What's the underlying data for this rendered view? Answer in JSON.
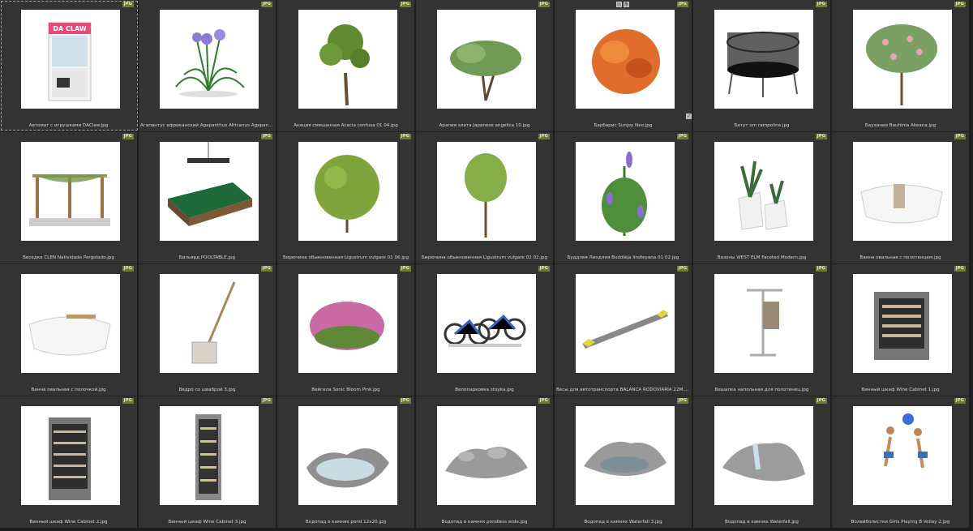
{
  "colors": {
    "background": "#1f1f1f",
    "cell": "#333333",
    "badge": "#6f7a33",
    "caption": "#d8d8d8"
  },
  "items": [
    {
      "name": "Автомат с игрушками DAClaw.jpg",
      "badge": "JPG",
      "kind": "claw",
      "title": "DA CLAW",
      "selected": true
    },
    {
      "name": "Агапантус африканский Agapanthus Africanus Agapanto ...",
      "badge": "JPG",
      "kind": "flower-blue"
    },
    {
      "name": "Акация смешанная Acacia confusa 01 04.jpg",
      "badge": "JPG",
      "kind": "tree"
    },
    {
      "name": "Аралия элата Japanese angelica 10.jpg",
      "badge": "JPG",
      "kind": "bush-wide"
    },
    {
      "name": "Барбарис Sunjoy Neo.jpg",
      "badge": "JPG",
      "kind": "orange-bush",
      "tools": [
        "square-icon",
        "pencil-icon"
      ],
      "checked": true
    },
    {
      "name": "Батут om rampoline.jpg",
      "badge": "JPG",
      "kind": "trampoline"
    },
    {
      "name": "Баухиния Bauhinia Akeana.jpg",
      "badge": "JPG",
      "kind": "blossom-tree"
    },
    {
      "name": "Беседка CLEN Natividade Pergolado.jpg",
      "badge": "JPG",
      "kind": "pergola"
    },
    {
      "name": "Бильярд POOLTABLE.jpg",
      "badge": "JPG",
      "kind": "pooltable"
    },
    {
      "name": "Бирючина обыкновенная Ligustrum vulgare 01 06.jpg",
      "badge": "JPG",
      "kind": "round-bush"
    },
    {
      "name": "Бирючина обыкновенная Ligustrum vulgare 02 02.jpg",
      "badge": "JPG",
      "kind": "small-tree"
    },
    {
      "name": "Буддлея Линдлея Buddleja lindleyana 01 02.jpg",
      "badge": "JPG",
      "kind": "buddleja"
    },
    {
      "name": "Вазоны WEST ELM Faceted Modern.jpg",
      "badge": "JPG",
      "kind": "planters"
    },
    {
      "name": "Ванна овальная с полотенцем.jpg",
      "badge": "JPG",
      "kind": "bathtub-towel"
    },
    {
      "name": "Ванна овальная с полочкой.jpg",
      "badge": "JPG",
      "kind": "bathtub-shelf"
    },
    {
      "name": "Ведро со шваброй 3.jpg",
      "badge": "JPG",
      "kind": "mop"
    },
    {
      "name": "Вейгела Sonic Bloom Pink.jpg",
      "badge": "JPG",
      "kind": "pink-bush"
    },
    {
      "name": "Велопарковка stoyka.jpg",
      "badge": "JPG",
      "kind": "bikes"
    },
    {
      "name": "Весы для автотранспорта BALANCA RODOVIARIA 22M.jpg",
      "badge": "JPG",
      "kind": "scale"
    },
    {
      "name": "Вешалка напольная для полотенец.jpg",
      "badge": "JPG",
      "kind": "towel-rack"
    },
    {
      "name": "Винный шкаф Wine Cabinet 1.jpg",
      "badge": "JPG",
      "kind": "wine-small"
    },
    {
      "name": "Винный шкаф Wine Cabinet 2.jpg",
      "badge": "JPG",
      "kind": "wine-tall"
    },
    {
      "name": "Винный шкаф Wine Cabinet 3.jpg",
      "badge": "JPG",
      "kind": "wine-narrow"
    },
    {
      "name": "Водопад в камнях pond 12x20.jpg",
      "badge": "JPG",
      "kind": "pond"
    },
    {
      "name": "Водопад в камнях pondless wide.jpg",
      "badge": "JPG",
      "kind": "rocks"
    },
    {
      "name": "Водопад в камнях Waterfall 3.jpg",
      "badge": "JPG",
      "kind": "rocks2"
    },
    {
      "name": "Водопад в камнях Waterfall.jpg",
      "badge": "JPG",
      "kind": "waterfall"
    },
    {
      "name": "Волейболистки Girls Playing B Volley 2.jpg",
      "badge": "JPG",
      "kind": "volley"
    }
  ]
}
